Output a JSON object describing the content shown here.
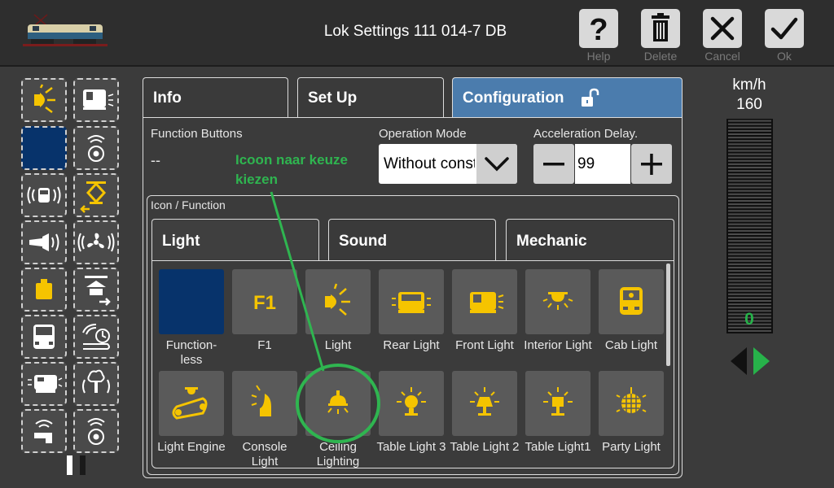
{
  "header": {
    "title": "Lok Settings 111 014-7 DB",
    "buttons": [
      {
        "label": "Help",
        "icon": "question-icon"
      },
      {
        "label": "Delete",
        "icon": "trash-icon"
      },
      {
        "label": "Cancel",
        "icon": "close-icon"
      },
      {
        "label": "Ok",
        "icon": "check-icon"
      }
    ]
  },
  "tabs": [
    {
      "label": "Info"
    },
    {
      "label": "Set Up"
    },
    {
      "label": "Configuration",
      "active": true,
      "icon": "unlock-icon"
    }
  ],
  "config": {
    "function_buttons_label": "Function Buttons",
    "function_buttons_value": "--",
    "operation_mode_label": "Operation Mode",
    "operation_mode_value": "Without constant",
    "acceleration_label": "Acceleration Delay.",
    "acceleration_value": "99",
    "minus": "−",
    "plus": "+"
  },
  "annotation": {
    "line1": "Icoon naar keuze",
    "line2": "kiezen",
    "color": "#2fb550"
  },
  "icon_function": {
    "label": "Icon / Function",
    "subtabs": [
      {
        "label": "Light",
        "active": true
      },
      {
        "label": "Sound"
      },
      {
        "label": "Mechanic"
      }
    ],
    "icons": [
      {
        "label": "Function-\nless",
        "icon": "functionless-icon"
      },
      {
        "label": "F1",
        "icon": "f1-icon"
      },
      {
        "label": "Light",
        "icon": "light-icon"
      },
      {
        "label": "Rear Light",
        "icon": "rear-light-icon"
      },
      {
        "label": "Front Light",
        "icon": "front-light-icon"
      },
      {
        "label": "Interior Light",
        "icon": "interior-light-icon"
      },
      {
        "label": "Cab Light",
        "icon": "cab-light-icon"
      },
      {
        "label": "Light Engine",
        "icon": "light-engine-icon"
      },
      {
        "label": "Console Light",
        "icon": "console-light-icon"
      },
      {
        "label": "Ceiling Lighting",
        "icon": "ceiling-lighting-icon"
      },
      {
        "label": "Table Light 3",
        "icon": "table-light-3-icon"
      },
      {
        "label": "Table Light 2",
        "icon": "table-light-2-icon"
      },
      {
        "label": "Table Light1",
        "icon": "table-light-1-icon"
      },
      {
        "label": "Party Light",
        "icon": "party-light-icon"
      }
    ]
  },
  "speed": {
    "unit": "km/h",
    "max": "160",
    "current": "0",
    "level": 0
  },
  "colors": {
    "accent": "#4b7cad",
    "icon_yellow": "#f5c400",
    "selected": "#07336b"
  }
}
